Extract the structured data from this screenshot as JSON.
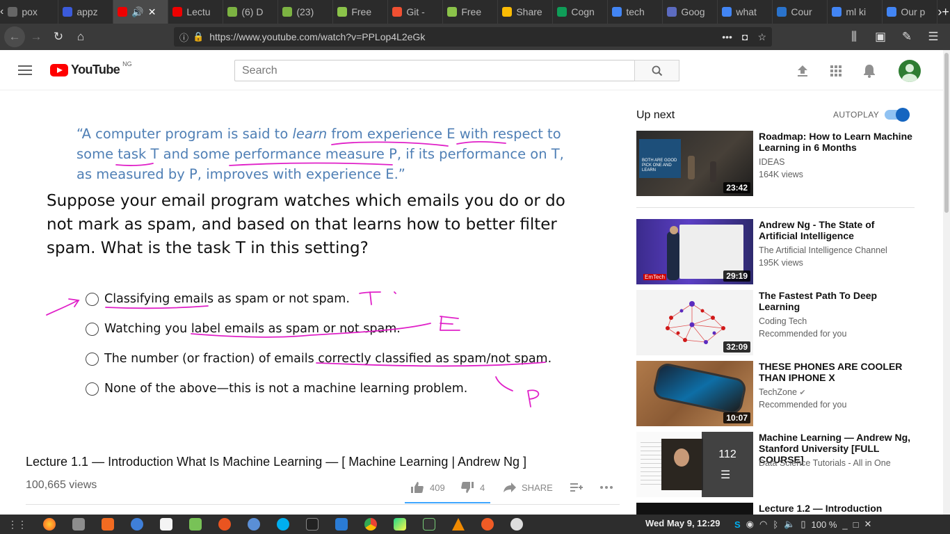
{
  "browser": {
    "tabs": [
      {
        "title": "pox",
        "color": "#666"
      },
      {
        "title": "appz",
        "color": "#3b5bdb"
      },
      {
        "title": "",
        "color": "#e00"
      },
      {
        "title": "Lectu",
        "color": "#e00"
      },
      {
        "title": "(6) D",
        "color": "#7cb342"
      },
      {
        "title": "(23) ",
        "color": "#7cb342"
      },
      {
        "title": "Free",
        "color": "#8bc34a"
      },
      {
        "title": "Git -",
        "color": "#f05032"
      },
      {
        "title": "Free",
        "color": "#8bc34a"
      },
      {
        "title": "Share",
        "color": "#fbbc04"
      },
      {
        "title": "Cogn",
        "color": "#0f9d58"
      },
      {
        "title": "tech",
        "color": "#4285f4"
      },
      {
        "title": "Goog",
        "color": "#5c6bc0"
      },
      {
        "title": "what",
        "color": "#4285f4"
      },
      {
        "title": "Cour",
        "color": "#2a73cc"
      },
      {
        "title": "ml ki",
        "color": "#4285f4"
      },
      {
        "title": "Our p",
        "color": "#4285f4"
      }
    ],
    "active_tab_audio": "🔊",
    "close_glyph": "✕",
    "url": "https://www.youtube.com/watch?v=PPLop4L2eGk",
    "url_actions": "•••"
  },
  "youtube": {
    "logo_text": "YouTube",
    "country": "NG",
    "search_placeholder": "Search"
  },
  "slide": {
    "quote": {
      "open": "“A computer program is said to ",
      "learn": "learn",
      "mid1": " from experience E with respect to some task T and some performance measure P, if its performance on T, as measured by P, improves with experience E.”"
    },
    "question": "Suppose your email program watches which emails you do or do not mark as spam, and based on that learns how to better filter spam.  What is the task T in this setting?",
    "options": [
      "Classifying emails as spam or not spam.",
      "Watching you label emails as spam or not spam.",
      "The number (or fraction) of emails correctly classified as spam/not spam.",
      "None of the above—this is not a machine learning problem."
    ]
  },
  "video": {
    "title": "Lecture 1.1 — Introduction What Is Machine Learning — [ Machine Learning | Andrew Ng ]",
    "views": "100,665 views",
    "likes": "409",
    "dislikes": "4",
    "share": "SHARE"
  },
  "sidebar": {
    "up_next": "Up next",
    "autoplay": "AUTOPLAY",
    "autoplay_on": true,
    "items": [
      {
        "title": "Roadmap: How to Learn Machine Learning in 6 Months",
        "channel": "IDEAS",
        "meta": "164K views",
        "duration": "23:42",
        "thumb_text": "BOTH ARE GOOD PICK ONE AND LEARN"
      },
      {
        "title": "Andrew Ng - The State of Artificial Intelligence",
        "channel": "The Artificial Intelligence Channel",
        "meta": "195K views",
        "duration": "29:19",
        "thumb_text": "EmTech"
      },
      {
        "title": "The Fastest Path To Deep Learning",
        "channel": "Coding Tech",
        "meta": "Recommended for you",
        "duration": "32:09"
      },
      {
        "title": "THESE PHONES ARE COOLER THAN IPHONE X",
        "channel": "TechZone",
        "meta": "Recommended for you",
        "duration": "10:07",
        "verified": "✔"
      },
      {
        "title": "Machine Learning — Andrew Ng, Stanford University [FULL COURSE]",
        "channel": "Data Science Tutorials - All in One",
        "meta": "",
        "duration": "",
        "playlist_count": "112"
      },
      {
        "title": "Lecture 1.2 — Introduction",
        "channel": "",
        "meta": "",
        "duration": ""
      }
    ]
  },
  "taskbar": {
    "clock": "Wed May  9, 12:29",
    "battery": "100 %"
  }
}
